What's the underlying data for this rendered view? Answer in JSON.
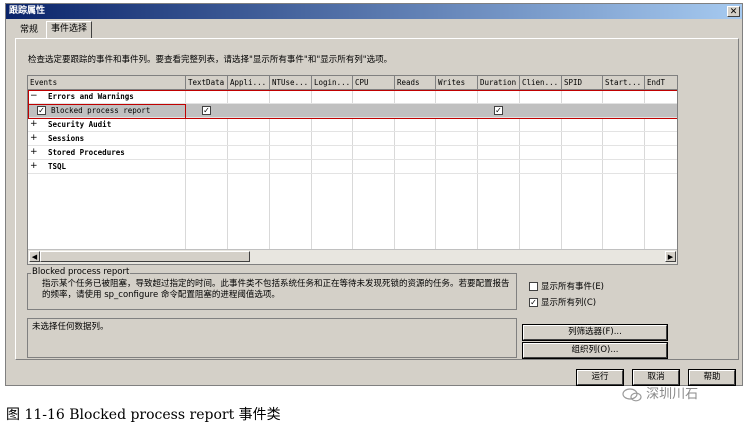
{
  "window": {
    "title": "跟踪属性",
    "close_glyph": "✕"
  },
  "tabs": [
    {
      "label": "常规"
    },
    {
      "label": "事件选择"
    }
  ],
  "instruction": "检查选定要跟踪的事件和事件列。要查看完整列表，请选择\"显示所有事件\"和\"显示所有列\"选项。",
  "grid": {
    "columns": [
      "Events",
      "TextData",
      "Appli...",
      "NTUse...",
      "Login...",
      "CPU",
      "Reads",
      "Writes",
      "Duration",
      "Clien...",
      "SPID",
      "Start...",
      "EndT"
    ],
    "rows": [
      {
        "kind": "category",
        "expander": "−",
        "label": "Errors and Warnings"
      },
      {
        "kind": "event",
        "label": "Blocked process report",
        "checked": true,
        "checked_columns": [
          "TextData",
          "Duration"
        ]
      },
      {
        "kind": "category",
        "expander": "+",
        "label": "Security Audit"
      },
      {
        "kind": "category",
        "expander": "+",
        "label": "Sessions"
      },
      {
        "kind": "category",
        "expander": "+",
        "label": "Stored Procedures"
      },
      {
        "kind": "category",
        "expander": "+",
        "label": "TSQL"
      }
    ],
    "scroll_left": "◀",
    "scroll_right": "▶"
  },
  "description": {
    "title": "Blocked process report",
    "text": "指示某个任务已被阻塞，导致超过指定的时间。此事件类不包括系统任务和正在等待未发现死锁的资源的任务。若要配置报告的频率，请使用 sp_configure 命令配置阻塞的进程阈值选项。"
  },
  "column_info": {
    "text": "未选择任何数据列。"
  },
  "options": {
    "show_all_events": {
      "label": "显示所有事件(E)",
      "checked": false
    },
    "show_all_columns": {
      "label": "显示所有列(C)",
      "checked": true
    }
  },
  "buttons": {
    "column_filters": "列筛选器(F)...",
    "organize_columns": "组织列(O)...",
    "run": "运行",
    "cancel": "取消",
    "help": "帮助"
  },
  "checkmark": "✓",
  "caption": "图 11-16 Blocked process report 事件类",
  "watermark": "深圳川石"
}
